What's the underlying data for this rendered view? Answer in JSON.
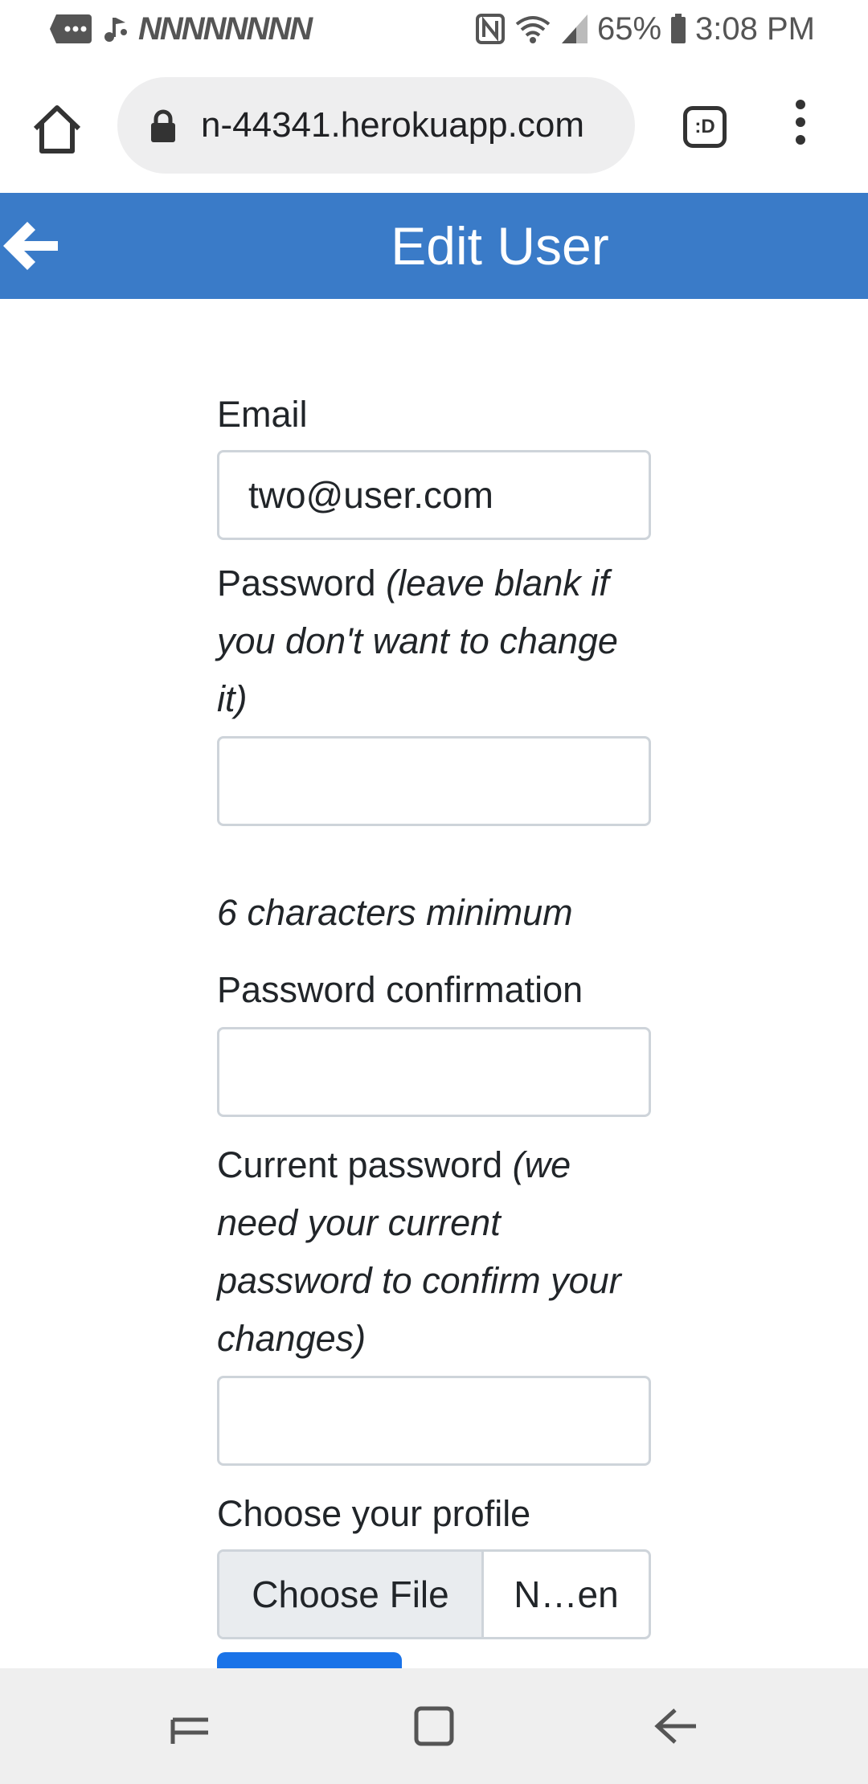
{
  "status_bar": {
    "n_icons": "NNNNNNNN",
    "battery": "65%",
    "time": "3:08 PM"
  },
  "browser": {
    "url": "n-44341.herokuapp.com",
    "tab_label": ":D"
  },
  "header": {
    "title": "Edit User",
    "color": "#3a7bc8"
  },
  "form": {
    "email_label": "Email",
    "email_value": "two@user.com",
    "password_label": "Password",
    "password_hint": "(leave blank if you don't want to change it)",
    "password_value": "",
    "password_help": "6 characters minimum",
    "confirm_label": "Password confirmation",
    "confirm_value": "",
    "current_label": "Current password",
    "current_hint": "(we need your current password to confirm your changes)",
    "current_value": "",
    "profile_label": "Choose your profile",
    "choose_file": "Choose File",
    "file_name": "N…en"
  }
}
